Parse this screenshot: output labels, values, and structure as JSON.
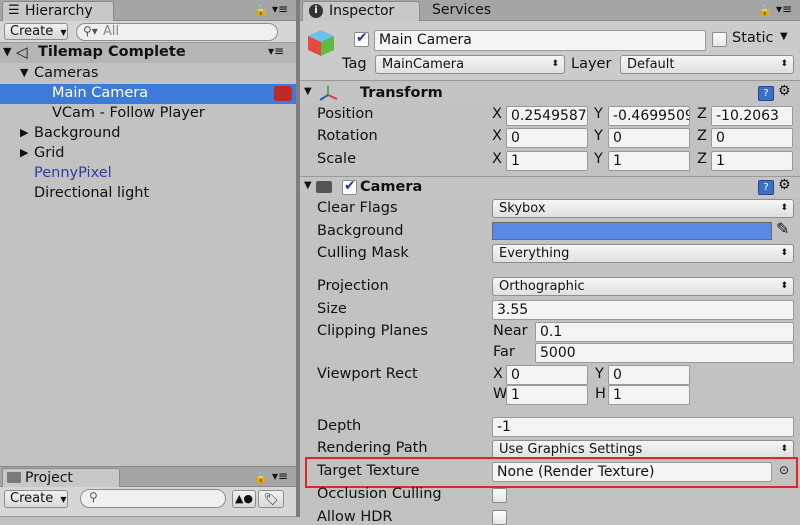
{
  "hierarchy": {
    "tab_label": "Hierarchy",
    "create_label": "Create",
    "search_placeholder": "All",
    "scene_name": "Tilemap Complete",
    "items": [
      {
        "label": "Cameras"
      },
      {
        "label": "Main Camera"
      },
      {
        "label": "VCam - Follow Player"
      },
      {
        "label": "Background"
      },
      {
        "label": "Grid"
      },
      {
        "label": "PennyPixel"
      },
      {
        "label": "Directional light"
      }
    ]
  },
  "project": {
    "tab_label": "Project",
    "create_label": "Create",
    "search_placeholder": ""
  },
  "inspector": {
    "tab_label": "Inspector",
    "services_label": "Services",
    "object_name": "Main Camera",
    "static_label": "Static",
    "tag_label": "Tag",
    "tag_value": "MainCamera",
    "layer_label": "Layer",
    "layer_value": "Default",
    "transform": {
      "title": "Transform",
      "position_label": "Position",
      "rotation_label": "Rotation",
      "scale_label": "Scale",
      "x": "X",
      "y": "Y",
      "z": "Z",
      "position": [
        "0.2549587",
        "-0.4699509",
        "-10.2063"
      ],
      "rotation": [
        "0",
        "0",
        "0"
      ],
      "scale": [
        "1",
        "1",
        "1"
      ]
    },
    "camera": {
      "title": "Camera",
      "clear_flags_label": "Clear Flags",
      "clear_flags_value": "Skybox",
      "background_label": "Background",
      "background_color": "#5a8ae6",
      "culling_mask_label": "Culling Mask",
      "culling_mask_value": "Everything",
      "projection_label": "Projection",
      "projection_value": "Orthographic",
      "size_label": "Size",
      "size_value": "3.55",
      "clipping_label": "Clipping Planes",
      "near_label": "Near",
      "near_value": "0.1",
      "far_label": "Far",
      "far_value": "5000",
      "viewport_label": "Viewport Rect",
      "vx_label": "X",
      "vx_value": "0",
      "vy_label": "Y",
      "vy_value": "0",
      "vw_label": "W",
      "vw_value": "1",
      "vh_label": "H",
      "vh_value": "1",
      "depth_label": "Depth",
      "depth_value": "-1",
      "rendering_path_label": "Rendering Path",
      "rendering_path_value": "Use Graphics Settings",
      "target_texture_label": "Target Texture",
      "target_texture_value": "None (Render Texture)",
      "occlusion_label": "Occlusion Culling",
      "allow_hdr_label": "Allow HDR"
    }
  },
  "colors": {
    "selection": "#3d7bd9",
    "highlight_box": "#e0252b",
    "prefab_blue": "#2a3fa0"
  }
}
